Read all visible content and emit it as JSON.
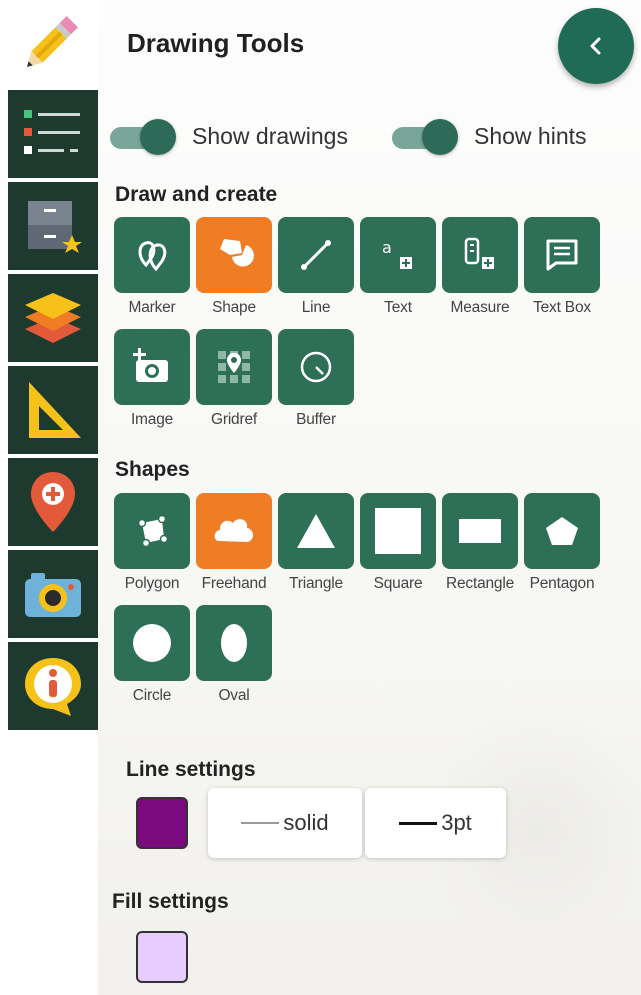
{
  "panel": {
    "title": "Drawing Tools",
    "toggles": [
      {
        "label": "Show drawings",
        "on": true
      },
      {
        "label": "Show hints",
        "on": true
      }
    ],
    "draw_section": "Draw and create",
    "draw_tools": [
      {
        "label": "Marker",
        "icon": "marker-icon",
        "active": false
      },
      {
        "label": "Shape",
        "icon": "shape-icon",
        "active": true
      },
      {
        "label": "Line",
        "icon": "line-icon",
        "active": false
      },
      {
        "label": "Text",
        "icon": "text-icon",
        "active": false
      },
      {
        "label": "Measure",
        "icon": "measure-icon",
        "active": false
      },
      {
        "label": "Text Box",
        "icon": "text-box-icon",
        "active": false
      },
      {
        "label": "Image",
        "icon": "add-photo-icon",
        "active": false
      },
      {
        "label": "Gridref",
        "icon": "gridref-icon",
        "active": false
      },
      {
        "label": "Buffer",
        "icon": "buffer-icon",
        "active": false
      }
    ],
    "shapes_section": "Shapes",
    "shapes": [
      {
        "label": "Polygon",
        "icon": "polygon-icon",
        "active": false
      },
      {
        "label": "Freehand",
        "icon": "freehand-icon",
        "active": true
      },
      {
        "label": "Triangle",
        "icon": "triangle-icon",
        "active": false
      },
      {
        "label": "Square",
        "icon": "square-icon",
        "active": false
      },
      {
        "label": "Rectangle",
        "icon": "rectangle-icon",
        "active": false
      },
      {
        "label": "Pentagon",
        "icon": "pentagon-icon",
        "active": false
      },
      {
        "label": "Circle",
        "icon": "circle-icon",
        "active": false
      },
      {
        "label": "Oval",
        "icon": "oval-icon",
        "active": false
      }
    ],
    "line_section": "Line settings",
    "line_color": "#7b0a7f",
    "line_style": "solid",
    "line_width": "3pt",
    "fill_section": "Fill settings",
    "fill_color": "#e6ccff"
  },
  "colors": {
    "accent": "#2e6f58",
    "active": "#f07c24",
    "rail": "#1e3a2f"
  },
  "rail_items": [
    "layer-list-icon",
    "saved-items-icon",
    "layers-icon",
    "measure-ruler-icon",
    "location-pin-icon",
    "camera-icon",
    "info-icon"
  ]
}
